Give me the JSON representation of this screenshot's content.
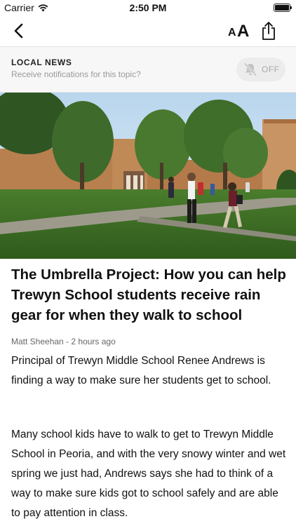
{
  "status_bar": {
    "carrier": "Carrier",
    "time": "2:50 PM"
  },
  "nav": {
    "font_small": "A",
    "font_large": "A"
  },
  "topic": {
    "name": "LOCAL NEWS",
    "prompt": "Receive notifications for this topic?",
    "toggle_state": "OFF"
  },
  "article": {
    "headline": "The Umbrella Project: How you can help Trewyn School students receive rain gear for when they walk to school",
    "byline": "Matt Sheehan - 2 hours ago",
    "paragraphs": [
      "Principal of Trewyn Middle School Renee Andrews is finding a way to make sure her students get to school.",
      "Many school kids have to walk to get to Trewyn Middle School in Peoria, and with the very snowy winter and wet spring we just had, Andrews says she had to think of a way to make sure kids got to school safely and are able to pay attention in class."
    ]
  },
  "colors": {
    "toggle_bg": "#ececec",
    "toggle_text": "#a8a8a8",
    "topic_bg": "#f7f7f7"
  }
}
